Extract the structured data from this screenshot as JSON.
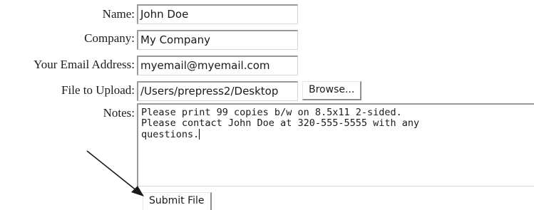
{
  "form": {
    "name": {
      "label": "Name:",
      "value": "John Doe"
    },
    "company": {
      "label": "Company:",
      "value": "My Company"
    },
    "email": {
      "label": "Your Email Address:",
      "value": "myemail@myemail.com"
    },
    "file": {
      "label": "File to Upload:",
      "value": "/Users/prepress2/Desktop",
      "browse_label": "Browse..."
    },
    "notes": {
      "label": "Notes:",
      "lines": [
        "Please print 99 copies b/w on 8.5x11 2-sided.",
        "Please contact John Doe at 320-555-5555 with any",
        "questions."
      ]
    },
    "submit_label": "Submit File"
  },
  "annotation": {
    "icon": "arrow-icon"
  }
}
